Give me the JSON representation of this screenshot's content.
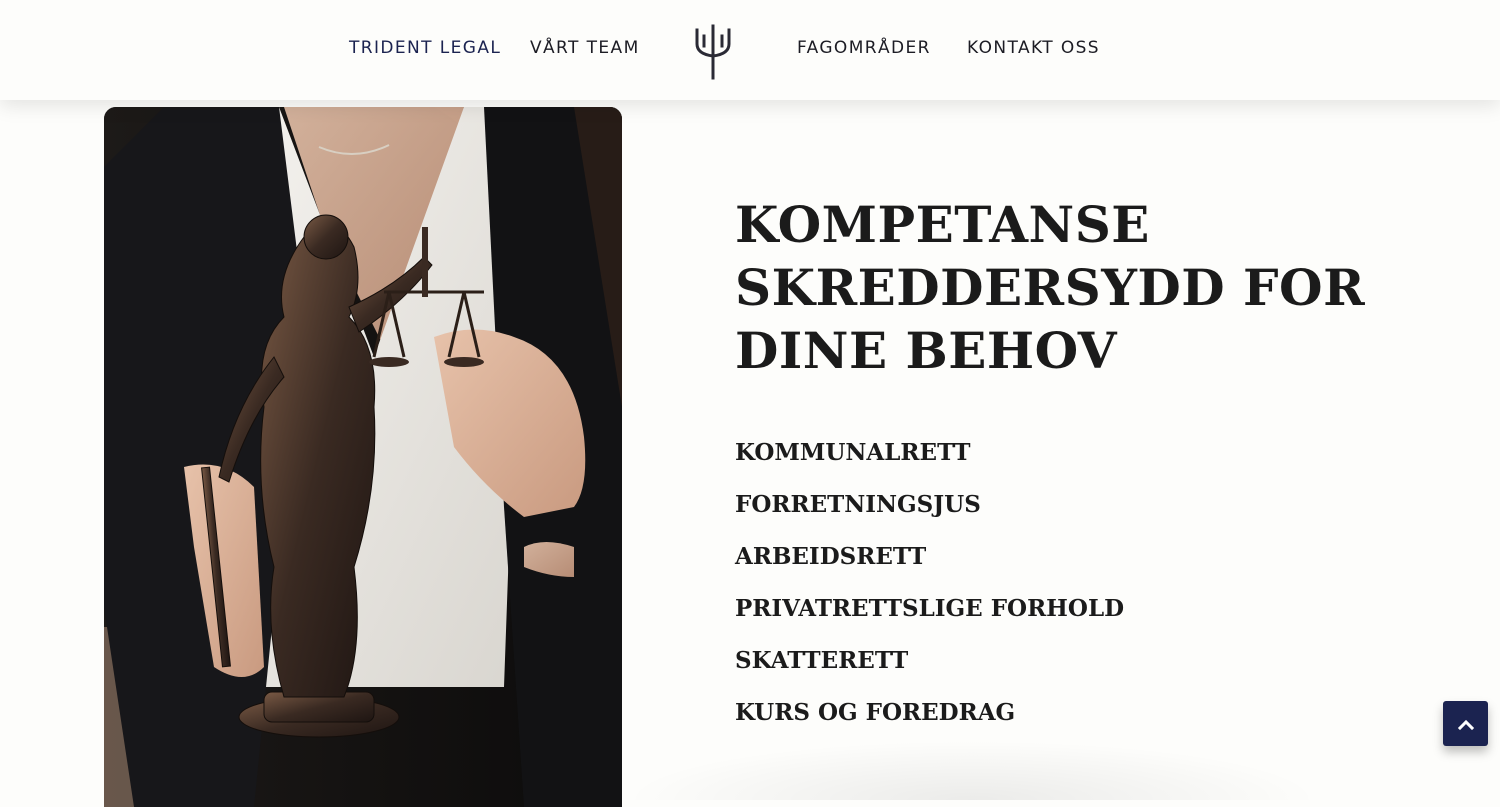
{
  "nav": {
    "items": [
      {
        "label": "TRIDENT LEGAL"
      },
      {
        "label": "VÅRT TEAM"
      },
      {
        "label": "FAGOMRÅDER"
      },
      {
        "label": "KONTAKT OSS"
      }
    ],
    "logo_icon": "trident-icon"
  },
  "hero": {
    "image_icon": "lady-justice-statue-photo",
    "headline": "KOMPETANSE SKREDDERSYDD FOR DINE BEHOV",
    "practice_areas": [
      "KOMMUNALRETT",
      "FORRETNINGSJUS",
      "ARBEIDSRETT",
      "PRIVATRETTSLIGE FORHOLD",
      "SKATTERETT",
      "KURS OG FOREDRAG"
    ]
  },
  "back_to_top": {
    "icon": "chevron-up-icon"
  },
  "colors": {
    "navy": "#1b2350",
    "background": "#fdfdfb",
    "text": "#1b1b1b"
  }
}
